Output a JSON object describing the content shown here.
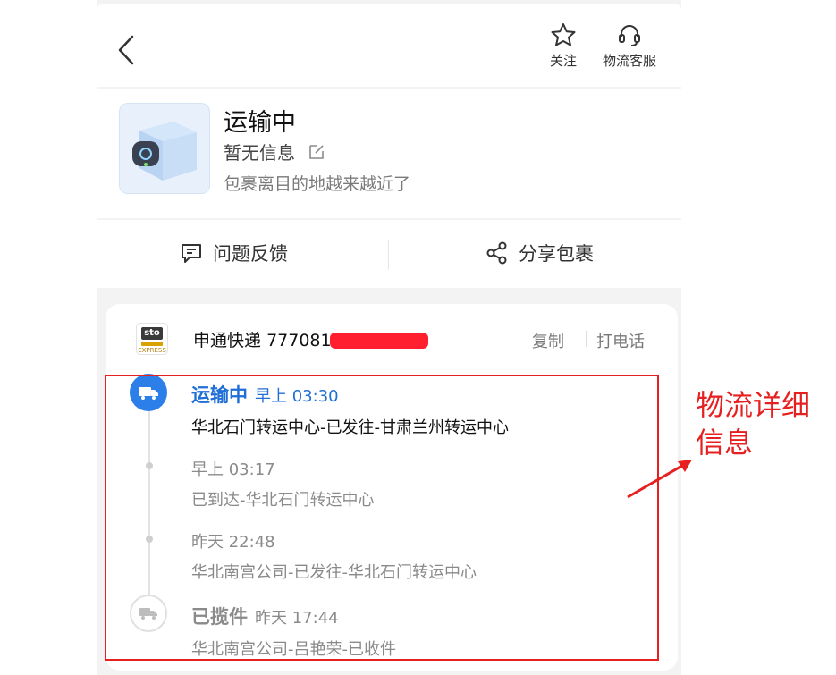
{
  "header": {
    "follow_label": "关注",
    "service_label": "物流客服"
  },
  "status": {
    "title": "运输中",
    "subtitle": "暂无信息",
    "note": "包裹离目的地越来越近了"
  },
  "actions": {
    "feedback_label": "问题反馈",
    "share_label": "分享包裹"
  },
  "tracking": {
    "carrier": "申通快递",
    "tracking_prefix": "777081",
    "copy_label": "复制",
    "call_label": "打电话",
    "events": [
      {
        "status": "运输中",
        "time": "早上 03:30",
        "detail": "华北石门转运中心-已发往-甘肃兰州转运中心"
      },
      {
        "time": "早上 03:17",
        "detail": "已到达-华北石门转运中心"
      },
      {
        "time": "昨天 22:48",
        "detail": "华北南宫公司-已发往-华北石门转运中心"
      },
      {
        "status": "已揽件",
        "time": "昨天 17:44",
        "detail": "华北南宫公司-吕艳荣-已收件"
      }
    ]
  },
  "annotation": {
    "text": "物流详细信息"
  },
  "colors": {
    "accent_blue": "#2c7ee8",
    "annotation_red": "#e62020"
  }
}
